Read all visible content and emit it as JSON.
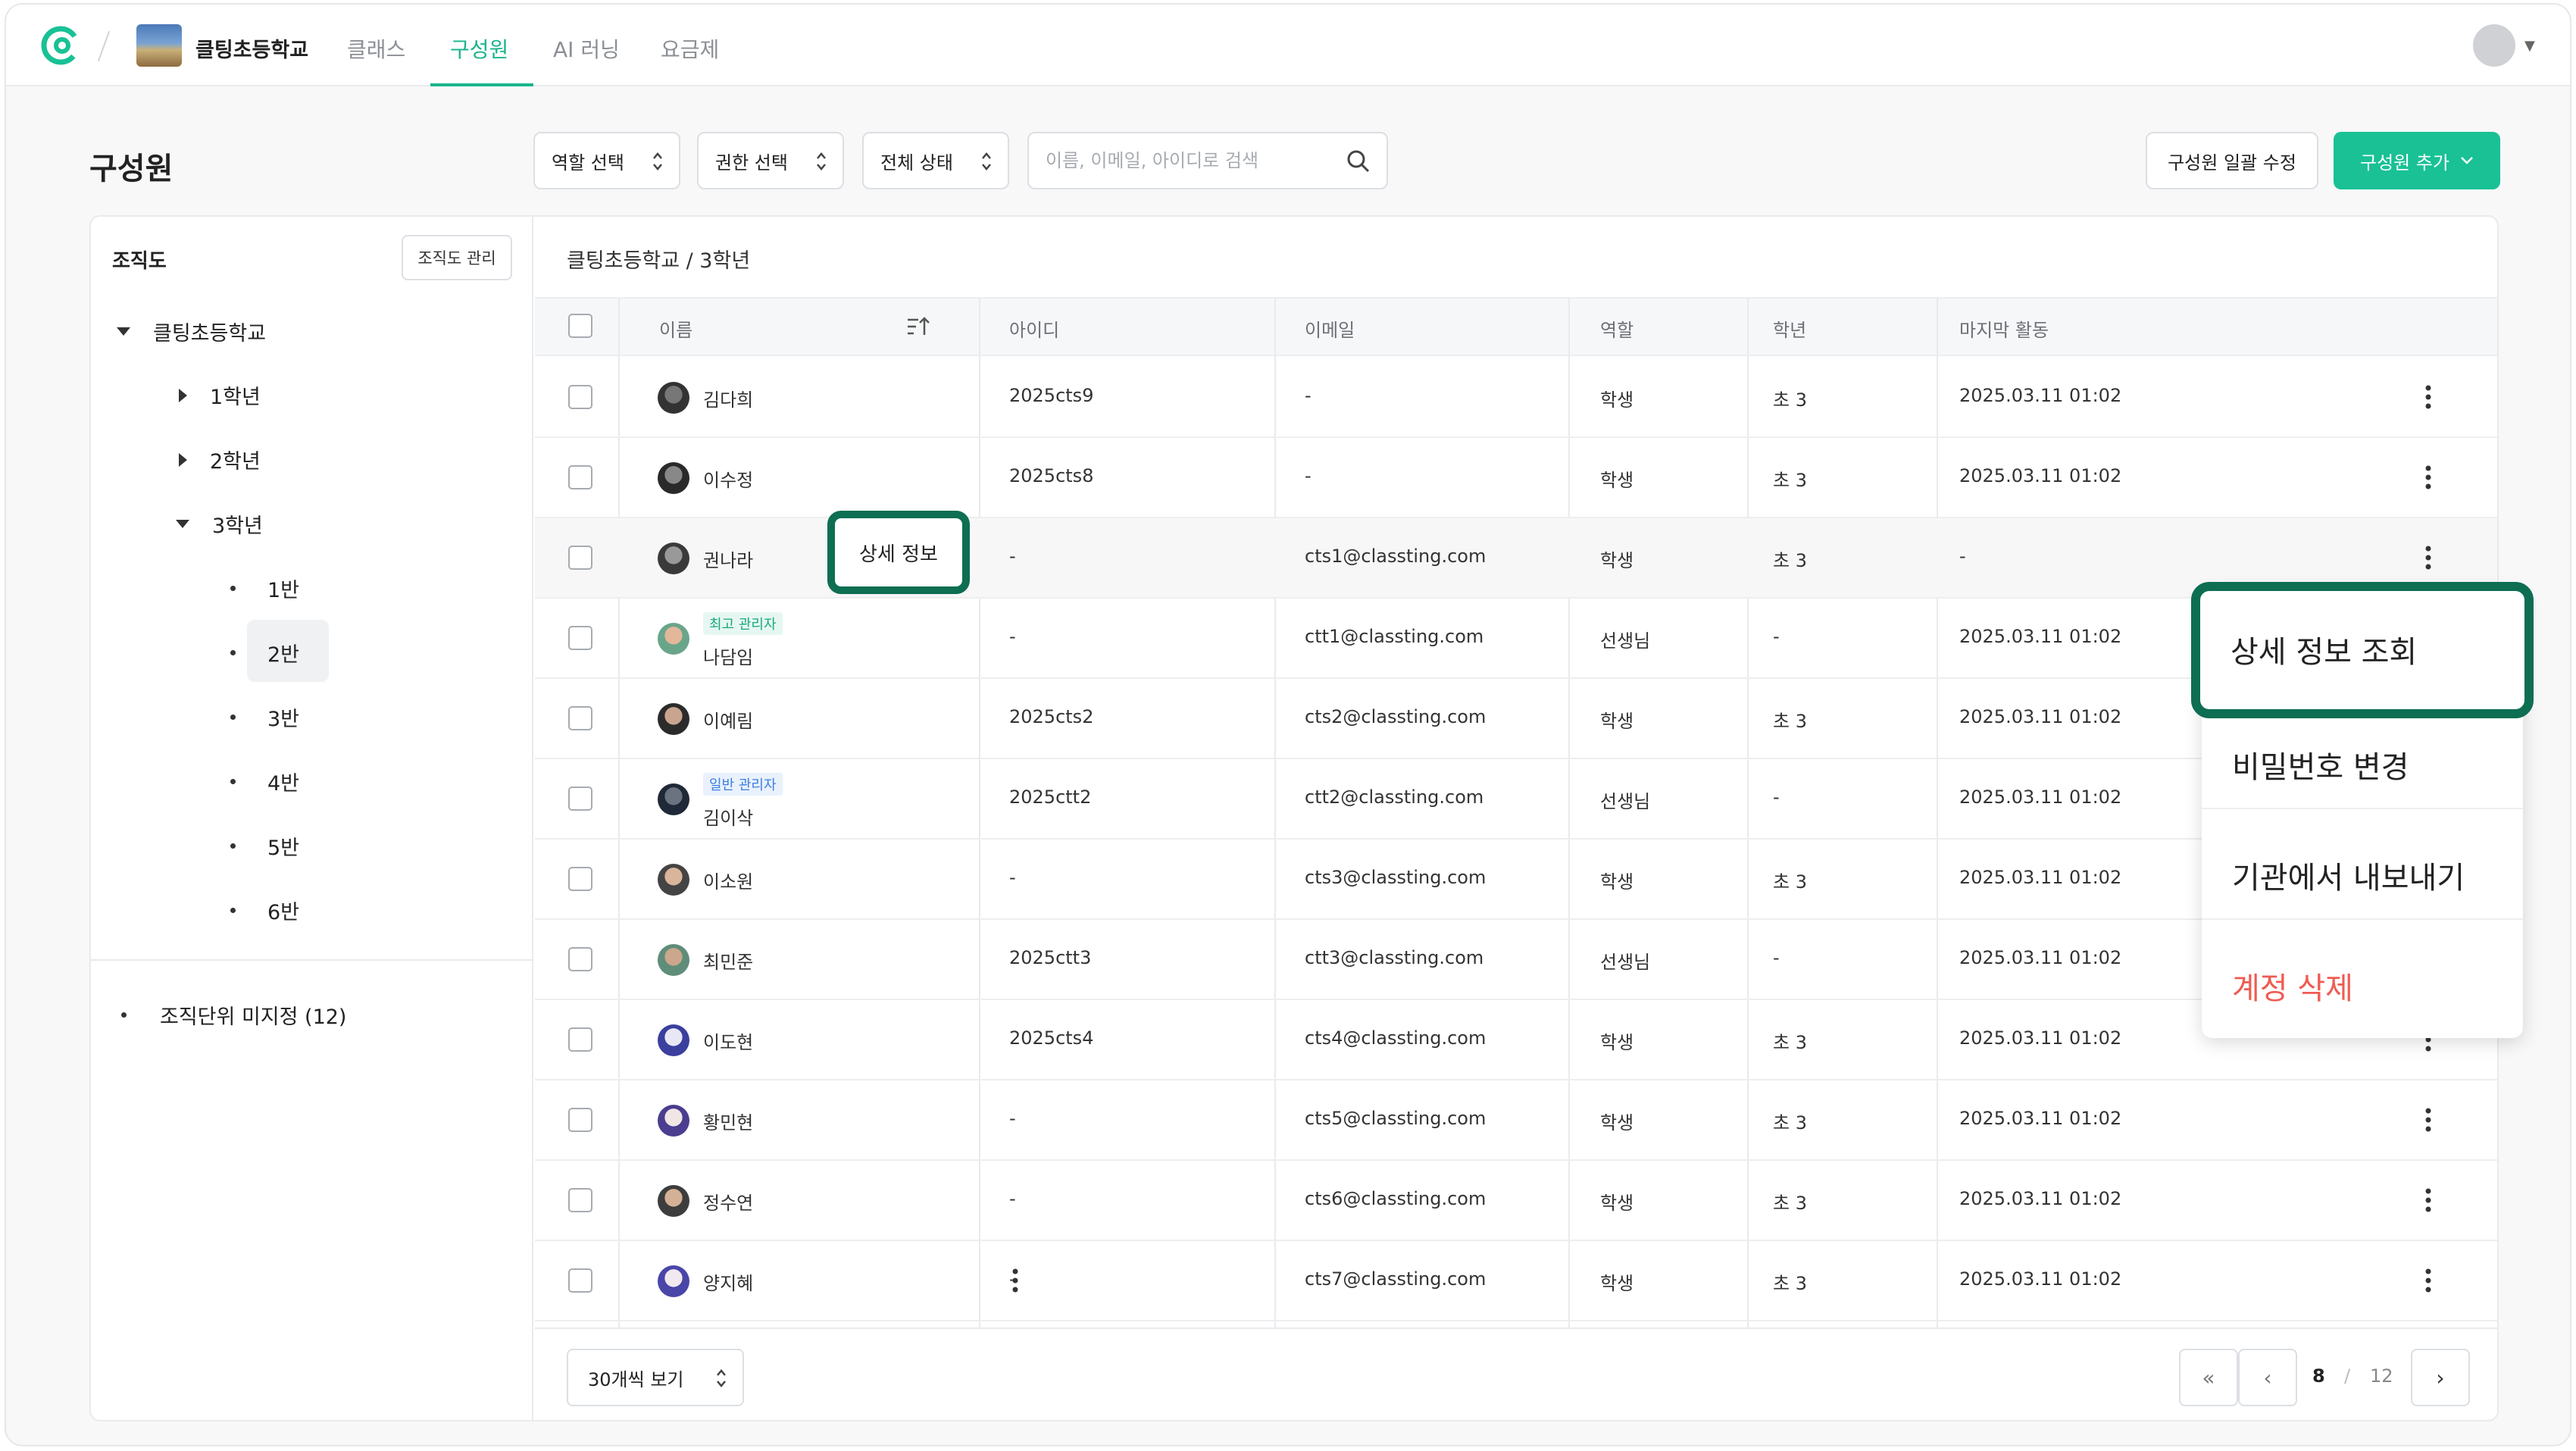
{
  "nav": {
    "school_name": "클팅초등학교",
    "items": [
      "클래스",
      "구성원",
      "AI 러닝",
      "요금제"
    ],
    "active": "구성원"
  },
  "toolbar": {
    "title": "구성원",
    "role_select": "역할 선택",
    "permission_select": "권한 선택",
    "status_select": "전체 상태",
    "search_placeholder": "이름, 이메일, 아이디로 검색",
    "bulk_edit": "구성원 일괄 수정",
    "add_member": "구성원 추가"
  },
  "sidebar": {
    "title": "조직도",
    "manage": "조직도 관리",
    "root": "클팅초등학교",
    "grades": [
      "1학년",
      "2학년",
      "3학년"
    ],
    "classes": [
      "1반",
      "2반",
      "3반",
      "4반",
      "5반",
      "6반"
    ],
    "selected_class": "2반",
    "unassigned": "조직단위 미지정 (12)"
  },
  "breadcrumb": "클팅초등학교 / 3학년",
  "table": {
    "headers": {
      "name": "이름",
      "id": "아이디",
      "email": "이메일",
      "role": "역할",
      "grade": "학년",
      "last_active": "마지막 활동"
    },
    "rows": [
      {
        "name": "김다희",
        "id": "2025cts9",
        "email": "-",
        "role": "학생",
        "grade": "초 3",
        "last": "2025.03.11 01:02",
        "badge": ""
      },
      {
        "name": "이수정",
        "id": "2025cts8",
        "email": "-",
        "role": "학생",
        "grade": "초 3",
        "last": "2025.03.11 01:02",
        "badge": ""
      },
      {
        "name": "권나라",
        "id": "-",
        "email": "cts1@classting.com",
        "role": "학생",
        "grade": "초 3",
        "last": "-",
        "badge": ""
      },
      {
        "name": "나담임",
        "id": "-",
        "email": "ctt1@classting.com",
        "role": "선생님",
        "grade": "-",
        "last": "2025.03.11 01:02",
        "badge": "최고 관리자"
      },
      {
        "name": "이예림",
        "id": "2025cts2",
        "email": "cts2@classting.com",
        "role": "학생",
        "grade": "초 3",
        "last": "2025.03.11 01:02",
        "badge": ""
      },
      {
        "name": "김이삭",
        "id": "2025ctt2",
        "email": "ctt2@classting.com",
        "role": "선생님",
        "grade": "-",
        "last": "2025.03.11 01:02",
        "badge": "일반 관리자"
      },
      {
        "name": "이소원",
        "id": "-",
        "email": "cts3@classting.com",
        "role": "학생",
        "grade": "초 3",
        "last": "2025.03.11 01:02",
        "badge": ""
      },
      {
        "name": "최민준",
        "id": "2025ctt3",
        "email": "ctt3@classting.com",
        "role": "선생님",
        "grade": "-",
        "last": "2025.03.11 01:02",
        "badge": ""
      },
      {
        "name": "이도현",
        "id": "2025cts4",
        "email": "cts4@classting.com",
        "role": "학생",
        "grade": "초 3",
        "last": "2025.03.11 01:02",
        "badge": ""
      },
      {
        "name": "황민현",
        "id": "-",
        "email": "cts5@classting.com",
        "role": "학생",
        "grade": "초 3",
        "last": "2025.03.11 01:02",
        "badge": ""
      },
      {
        "name": "정수연",
        "id": "-",
        "email": "cts6@classting.com",
        "role": "학생",
        "grade": "초 3",
        "last": "2025.03.11 01:02",
        "badge": ""
      },
      {
        "name": "양지혜",
        "id": "-",
        "email": "cts7@classting.com",
        "role": "학생",
        "grade": "초 3",
        "last": "2025.03.11 01:02",
        "badge": ""
      }
    ],
    "detail_button": "상세 정보"
  },
  "footer": {
    "page_size": "30개씩 보기",
    "current_page": "8",
    "separator": "/",
    "total_pages": "12"
  },
  "context_menu": {
    "items": [
      "상세 정보 조회",
      "비밀번호 변경",
      "기관에서 내보내기",
      "계정 삭제"
    ]
  },
  "colors": {
    "accent": "#19c195",
    "highlight": "#0d6e52",
    "danger": "#ef5b52"
  }
}
